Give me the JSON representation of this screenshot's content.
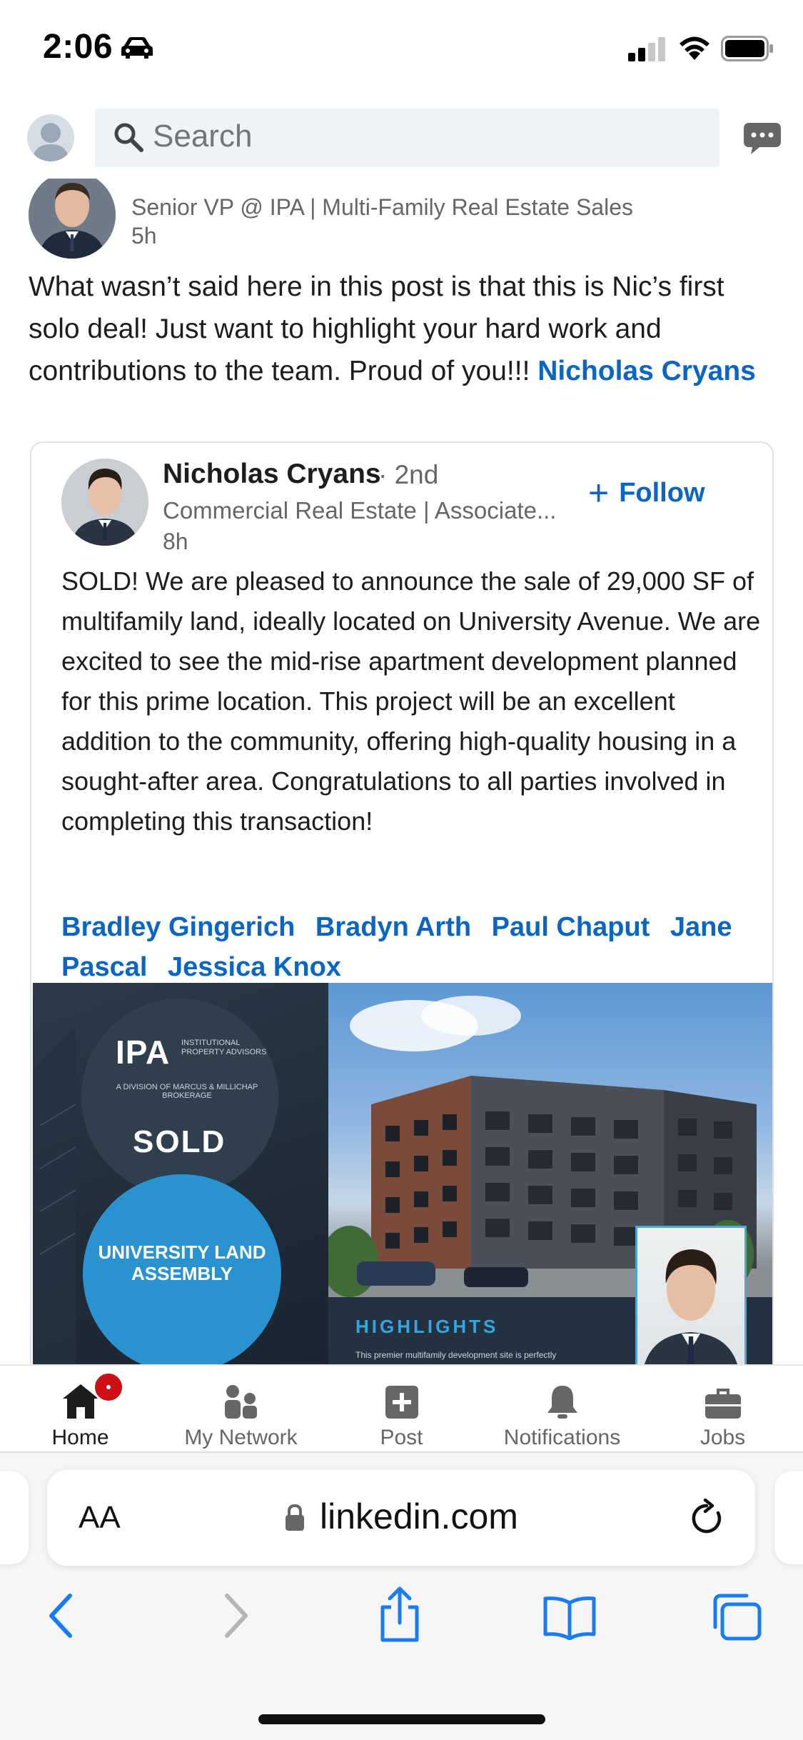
{
  "status_bar": {
    "time": "2:06"
  },
  "header": {
    "search_placeholder": "Search"
  },
  "post": {
    "author_headline": "Senior VP @ IPA | Multi-Family Real Estate Sales",
    "time": "5h",
    "commentary": "What wasn’t said here in this post is that this is Nic’s first solo deal! Just want to highlight your hard work and contributions to the team. Proud of you!!! ",
    "mention": "Nicholas Cryans",
    "shared": {
      "author_name": "Nicholas Cryans",
      "degree": "· 2nd",
      "headline": "Commercial Real Estate | Associate...",
      "time": "8h",
      "follow_label": "Follow",
      "body": "SOLD! We are pleased to announce the sale of 29,000 SF of multifamily land, ideally located on University Avenue. We are excited to see the mid-rise apartment development planned for this prime location. This project will be an excellent addition to the community, offering high-quality housing in a sought-after area. Congratulations to all parties involved in completing this transaction!",
      "tags": [
        "Bradley Gingerich",
        "Bradyn Arth",
        "Paul Chaput",
        "Jane Pascal",
        "Jessica Knox"
      ],
      "image": {
        "logo": "IPA",
        "logo_sub": "INSTITUTIONAL PROPERTY ADVISORS",
        "brokerage": "A DIVISION OF MARCUS & MILLICHAP BROKERAGE",
        "sold": "SOLD",
        "title": "UNIVERSITY LAND ASSEMBLY",
        "highlights": "HIGHLIGHTS",
        "highlights_text": "This premier multifamily development site is perfectly"
      }
    }
  },
  "tab_bar": {
    "tabs": [
      {
        "label": "Home",
        "icon": "home-icon",
        "active": true
      },
      {
        "label": "My Network",
        "icon": "network-icon",
        "active": false
      },
      {
        "label": "Post",
        "icon": "post-icon",
        "active": false
      },
      {
        "label": "Notifications",
        "icon": "bell-icon",
        "active": false
      },
      {
        "label": "Jobs",
        "icon": "briefcase-icon",
        "active": false
      }
    ]
  },
  "safari": {
    "aa": "AA",
    "url": "linkedin.com"
  },
  "colors": {
    "link": "#0a66c2",
    "badge": "#cc1016",
    "ipa_blue": "#2a93cf"
  }
}
